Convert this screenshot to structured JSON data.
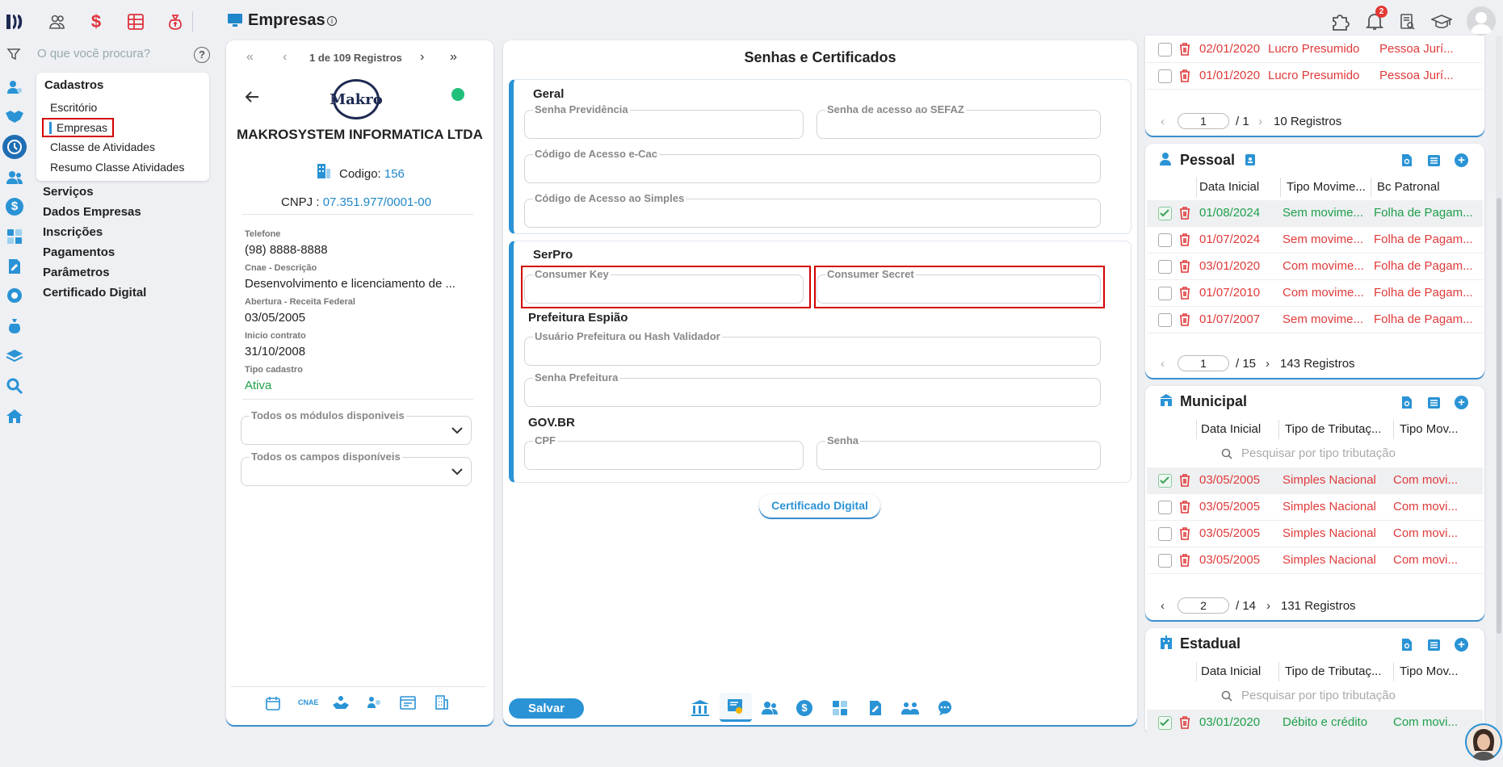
{
  "header": {
    "title": "Empresas"
  },
  "search": {
    "placeholder": "O que você procura?"
  },
  "notifications": {
    "count": "2"
  },
  "menu": {
    "section": "Cadastros",
    "sub_items": [
      "Escritório",
      "Empresas",
      "Classe de Atividades",
      "Resumo Classe Atividades"
    ],
    "main_items": [
      "Serviços",
      "Dados Empresas",
      "Inscrições",
      "Pagamentos",
      "Parâmetros",
      "Certificado Digital"
    ]
  },
  "record_nav": {
    "label": "1 de 109 Registros"
  },
  "company": {
    "logo_text": "Makro",
    "name": "MAKROSYSTEM INFORMATICA LTDA",
    "codigo_label": "Codigo:",
    "codigo": "156",
    "cnpj_label": "CNPJ :",
    "cnpj": "07.351.977/0001-00",
    "telefone_label": "Telefone",
    "telefone": "(98) 8888-8888",
    "cnae_label": "Cnae - Descrição",
    "cnae": "Desenvolvimento e licenciamento de ...",
    "abertura_label": "Abertura - Receita Federal",
    "abertura": "03/05/2005",
    "inicio_label": "Inicio contrato",
    "inicio": "31/10/2008",
    "tipo_label": "Tipo cadastro",
    "tipo": "Ativa",
    "modulos_label": "Todos os módulos disponiveis",
    "campos_label": "Todos os campos disponíveis",
    "cnae_tab": "CNAE"
  },
  "form": {
    "title": "Senhas e Certificados",
    "geral": "Geral",
    "senha_previdencia": "Senha Previdência",
    "senha_sefaz": "Senha de acesso ao SEFAZ",
    "codigo_ecac": "Código de Acesso e-Cac",
    "codigo_simples": "Código de Acesso ao Simples",
    "serpro": "SerPro",
    "consumer_key": "Consumer Key",
    "consumer_secret": "Consumer Secret",
    "prefeitura": "Prefeitura Espião",
    "usuario_prefeitura": "Usuário Prefeitura ou Hash Validador",
    "senha_prefeitura": "Senha Prefeitura",
    "govbr": "GOV.BR",
    "cpf": "CPF",
    "senha": "Senha",
    "certificado_button": "Certificado Digital",
    "save_button": "Salvar"
  },
  "top_table": {
    "rows": [
      {
        "date": "02/01/2020",
        "c2": "Lucro Presumido",
        "c3": "Pessoa Jurí..."
      },
      {
        "date": "01/01/2020",
        "c2": "Lucro Presumido",
        "c3": "Pessoa Jurí..."
      }
    ],
    "page": "1",
    "total_pages": "/ 1",
    "records": "10 Registros"
  },
  "pessoal": {
    "title": "Pessoal",
    "headers": [
      "Data Inicial",
      "Tipo Movime...",
      "Bc Patronal"
    ],
    "rows": [
      {
        "date": "01/08/2024",
        "c2": "Sem movime...",
        "c3": "Folha de Pagam..."
      },
      {
        "date": "01/07/2024",
        "c2": "Sem movime...",
        "c3": "Folha de Pagam..."
      },
      {
        "date": "03/01/2020",
        "c2": "Com movime...",
        "c3": "Folha de Pagam..."
      },
      {
        "date": "01/07/2010",
        "c2": "Com movime...",
        "c3": "Folha de Pagam..."
      },
      {
        "date": "01/07/2007",
        "c2": "Sem movime...",
        "c3": "Folha de Pagam..."
      }
    ],
    "page": "1",
    "total_pages": "/ 15",
    "records": "143 Registros"
  },
  "municipal": {
    "title": "Municipal",
    "headers": [
      "Data Inicial",
      "Tipo de Tributaç...",
      "Tipo Mov..."
    ],
    "search_placeholder": "Pesquisar por tipo tributação",
    "rows": [
      {
        "date": "03/05/2005",
        "c2": "Simples Nacional",
        "c3": "Com movi..."
      },
      {
        "date": "03/05/2005",
        "c2": "Simples Nacional",
        "c3": "Com movi..."
      },
      {
        "date": "03/05/2005",
        "c2": "Simples Nacional",
        "c3": "Com movi..."
      },
      {
        "date": "03/05/2005",
        "c2": "Simples Nacional",
        "c3": "Com movi..."
      }
    ],
    "page": "2",
    "total_pages": "/ 14",
    "records": "131 Registros"
  },
  "estadual": {
    "title": "Estadual",
    "headers": [
      "Data Inicial",
      "Tipo de Tributaç...",
      "Tipo Mov..."
    ],
    "search_placeholder": "Pesquisar por tipo tributação",
    "rows": [
      {
        "date": "03/01/2020",
        "c2": "Débito e crédito",
        "c3": "Com movi..."
      }
    ]
  }
}
